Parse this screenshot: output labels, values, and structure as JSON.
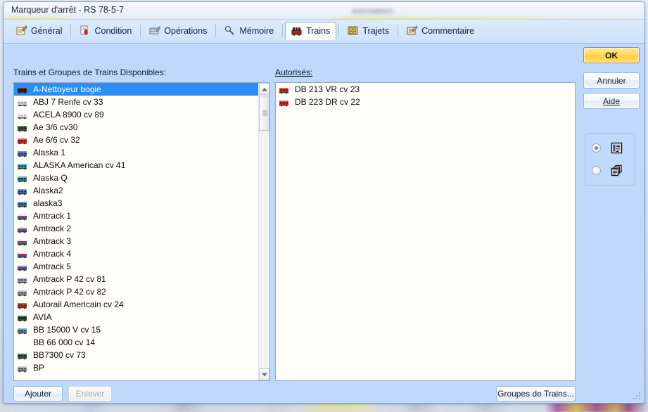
{
  "window": {
    "title": "Marqueur d'arrêt - RS 78-5-7"
  },
  "tabs": [
    {
      "label": "Général",
      "icon": "notepad-pencil-icon",
      "active": false
    },
    {
      "label": "Condition",
      "icon": "document-drop-icon",
      "active": false
    },
    {
      "label": "Opérations",
      "icon": "tools-grid-icon",
      "active": false
    },
    {
      "label": "Mémoire",
      "icon": "magnifier-icon",
      "active": false
    },
    {
      "label": "Trains",
      "icon": "train-icon",
      "active": true
    },
    {
      "label": "Trajets",
      "icon": "routes-grid-icon",
      "active": false
    },
    {
      "label": "Commentaire",
      "icon": "note-pencil-icon",
      "active": false
    }
  ],
  "labels": {
    "available": "Trains et Groupes de Trains Disponibles:",
    "authorized": "Autorisés:"
  },
  "available_trains": [
    {
      "name": "A-Nettoyeur bogie",
      "icon": "train-dark-icon",
      "selected": true
    },
    {
      "name": "ABJ 7 Renfe cv 33",
      "icon": "train-silver-icon",
      "selected": false
    },
    {
      "name": "ACELA 8900 cv 89",
      "icon": "train-white-icon",
      "selected": false
    },
    {
      "name": "Ae 3/6 cv30",
      "icon": "train-green-icon",
      "selected": false
    },
    {
      "name": "Ae 6/6 cv 32",
      "icon": "train-red-icon",
      "selected": false
    },
    {
      "name": "Alaska 1",
      "icon": "train-blue-icon",
      "selected": false
    },
    {
      "name": "ALASKA American cv 41",
      "icon": "train-cyan-icon",
      "selected": false
    },
    {
      "name": "Alaska Q",
      "icon": "train-teal-icon",
      "selected": false
    },
    {
      "name": "Alaska2",
      "icon": "train-blue-icon",
      "selected": false
    },
    {
      "name": "alaska3",
      "icon": "train-blue-icon",
      "selected": false
    },
    {
      "name": "Amtrack 1",
      "icon": "train-amtrak-icon",
      "selected": false
    },
    {
      "name": "Amtrack 2",
      "icon": "train-amtrak-icon",
      "selected": false
    },
    {
      "name": "Amtrack 3",
      "icon": "train-amtrak-icon",
      "selected": false
    },
    {
      "name": "Amtrack 4",
      "icon": "train-amtrak-icon",
      "selected": false
    },
    {
      "name": "Amtrack 5",
      "icon": "train-amtrak-icon",
      "selected": false
    },
    {
      "name": "Amtrack P 42 cv 81",
      "icon": "train-grey-icon",
      "selected": false
    },
    {
      "name": "Amtrack P 42 cv 82",
      "icon": "train-grey-icon",
      "selected": false
    },
    {
      "name": "Autorail Americain cv 24",
      "icon": "train-maroon-icon",
      "selected": false
    },
    {
      "name": "AVIA",
      "icon": "train-dkgreen-icon",
      "selected": false
    },
    {
      "name": "BB 15000 V  cv 15",
      "icon": "train-steel-icon",
      "selected": false
    },
    {
      "name": "BB 66 000 cv 14",
      "icon": "none",
      "selected": false
    },
    {
      "name": "BB7300 cv 73",
      "icon": "train-green-icon",
      "selected": false
    },
    {
      "name": "BP",
      "icon": "train-grey-icon",
      "selected": false
    }
  ],
  "authorized_trains": [
    {
      "name": "DB 213 VR cv 23",
      "icon": "train-red-icon"
    },
    {
      "name": "DB 223 DR cv 22",
      "icon": "train-red-icon"
    }
  ],
  "buttons": {
    "ok": "OK",
    "cancel": "Annuler",
    "help": "Aide",
    "add": "Ajouter",
    "remove": "Enlever",
    "groups": "Groupes de Trains..."
  },
  "view_modes": [
    {
      "name": "list-view",
      "icon": "list-lines-icon",
      "selected": true
    },
    {
      "name": "tile-view",
      "icon": "stacked-docs-icon",
      "selected": false
    }
  ],
  "colors": {
    "dialog_bg": "#bed9fb",
    "selection": "#2a8ef4",
    "list_bg": "#fffef7",
    "ok_accent": "#fdcd3d"
  }
}
